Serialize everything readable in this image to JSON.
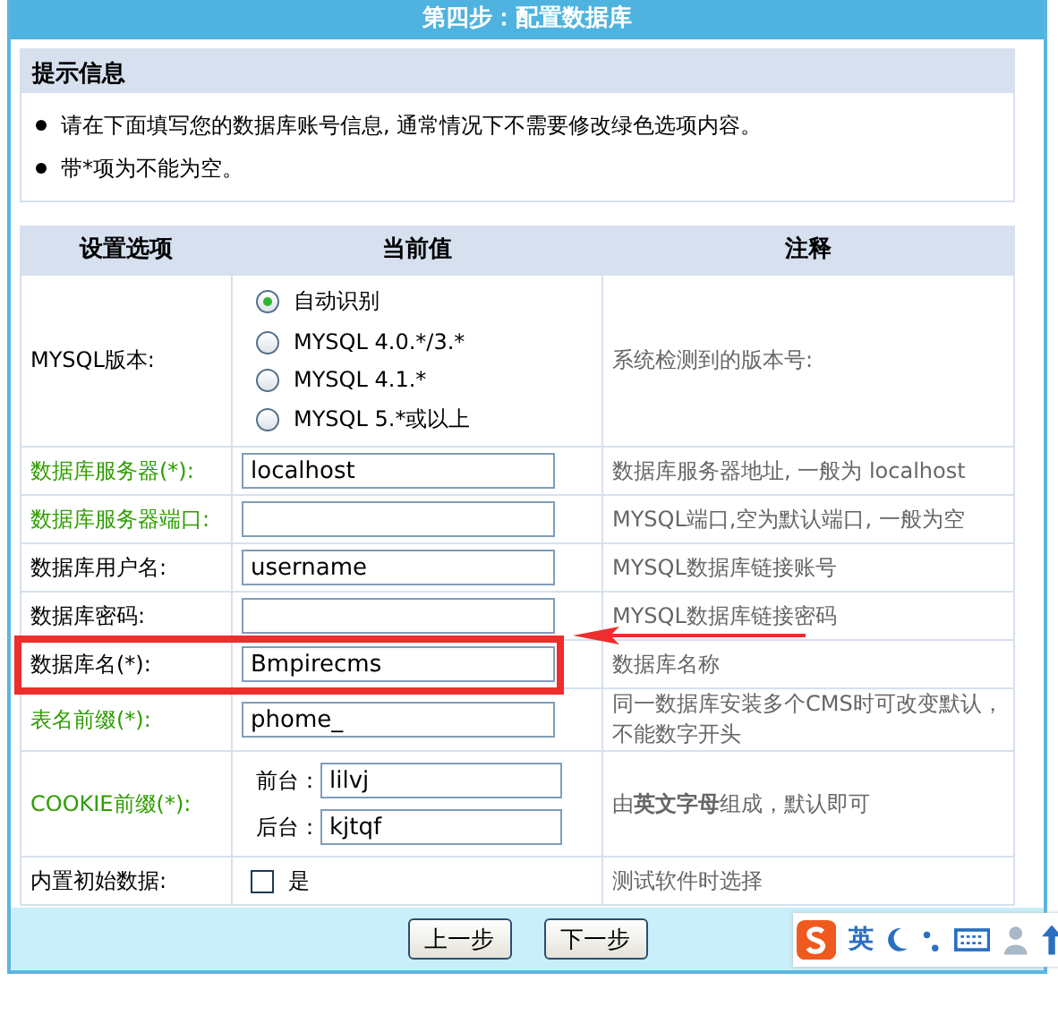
{
  "title": "第四步：配置数据库",
  "hint": {
    "title": "提示信息",
    "items": [
      "请在下面填写您的数据库账号信息, 通常情况下不需要修改绿色选项内容。",
      "带*项为不能为空。"
    ]
  },
  "table": {
    "columns": [
      "设置选项",
      "当前值",
      "注释"
    ],
    "rows": [
      {
        "label": "MYSQL版本:",
        "color": "#000000",
        "kind": "radio",
        "highlighted": false,
        "options": [
          {
            "label": "自动识别",
            "selected": true
          },
          {
            "label": "MYSQL 4.0.*/3.*",
            "selected": false
          },
          {
            "label": "MYSQL 4.1.*",
            "selected": false
          },
          {
            "label": "MYSQL 5.*或以上",
            "selected": false
          }
        ],
        "note": "系统检测到的版本号:"
      },
      {
        "label": "数据库服务器(*):",
        "color": "#2f9e00",
        "kind": "text",
        "highlighted": false,
        "value": "localhost",
        "note": "数据库服务器地址, 一般为 localhost"
      },
      {
        "label": "数据库服务器端口:",
        "color": "#2f9e00",
        "kind": "text",
        "highlighted": false,
        "note": "MYSQL端口,空为默认端口, 一般为空"
      },
      {
        "label": "数据库用户名:",
        "color": "#000000",
        "kind": "text",
        "highlighted": false,
        "value": "username",
        "note": "MYSQL数据库链接账号"
      },
      {
        "label": "数据库密码:",
        "color": "#000000",
        "kind": "text",
        "highlighted": false,
        "note": "MYSQL数据库链接密码"
      },
      {
        "label": "数据库名(*):",
        "color": "#000000",
        "kind": "text",
        "highlighted": true,
        "value": "Bmpirecms",
        "note": "数据库名称"
      },
      {
        "label": "表名前缀(*):",
        "color": "#2f9e00",
        "kind": "text",
        "highlighted": false,
        "value": "phome_",
        "note": "同一数据库安装多个CMS时可改变默认，不能数字开头"
      },
      {
        "label": "COOKIE前缀(*):",
        "color": "#2f9e00",
        "kind": "pair",
        "highlighted": false,
        "fields": [
          {
            "label": "前台：",
            "value": "lilvj"
          },
          {
            "label": "后台：",
            "value": "kjtqf"
          }
        ],
        "note": "由**英文字母**组成，默认即可"
      },
      {
        "label": "内置初始数据:",
        "color": "#000000",
        "kind": "checkbox",
        "highlighted": false,
        "checked": false,
        "option": "是",
        "note": "测试软件时选择"
      }
    ]
  },
  "buttons": [
    "上一步",
    "下一步"
  ],
  "ime": {
    "mode": "英"
  }
}
